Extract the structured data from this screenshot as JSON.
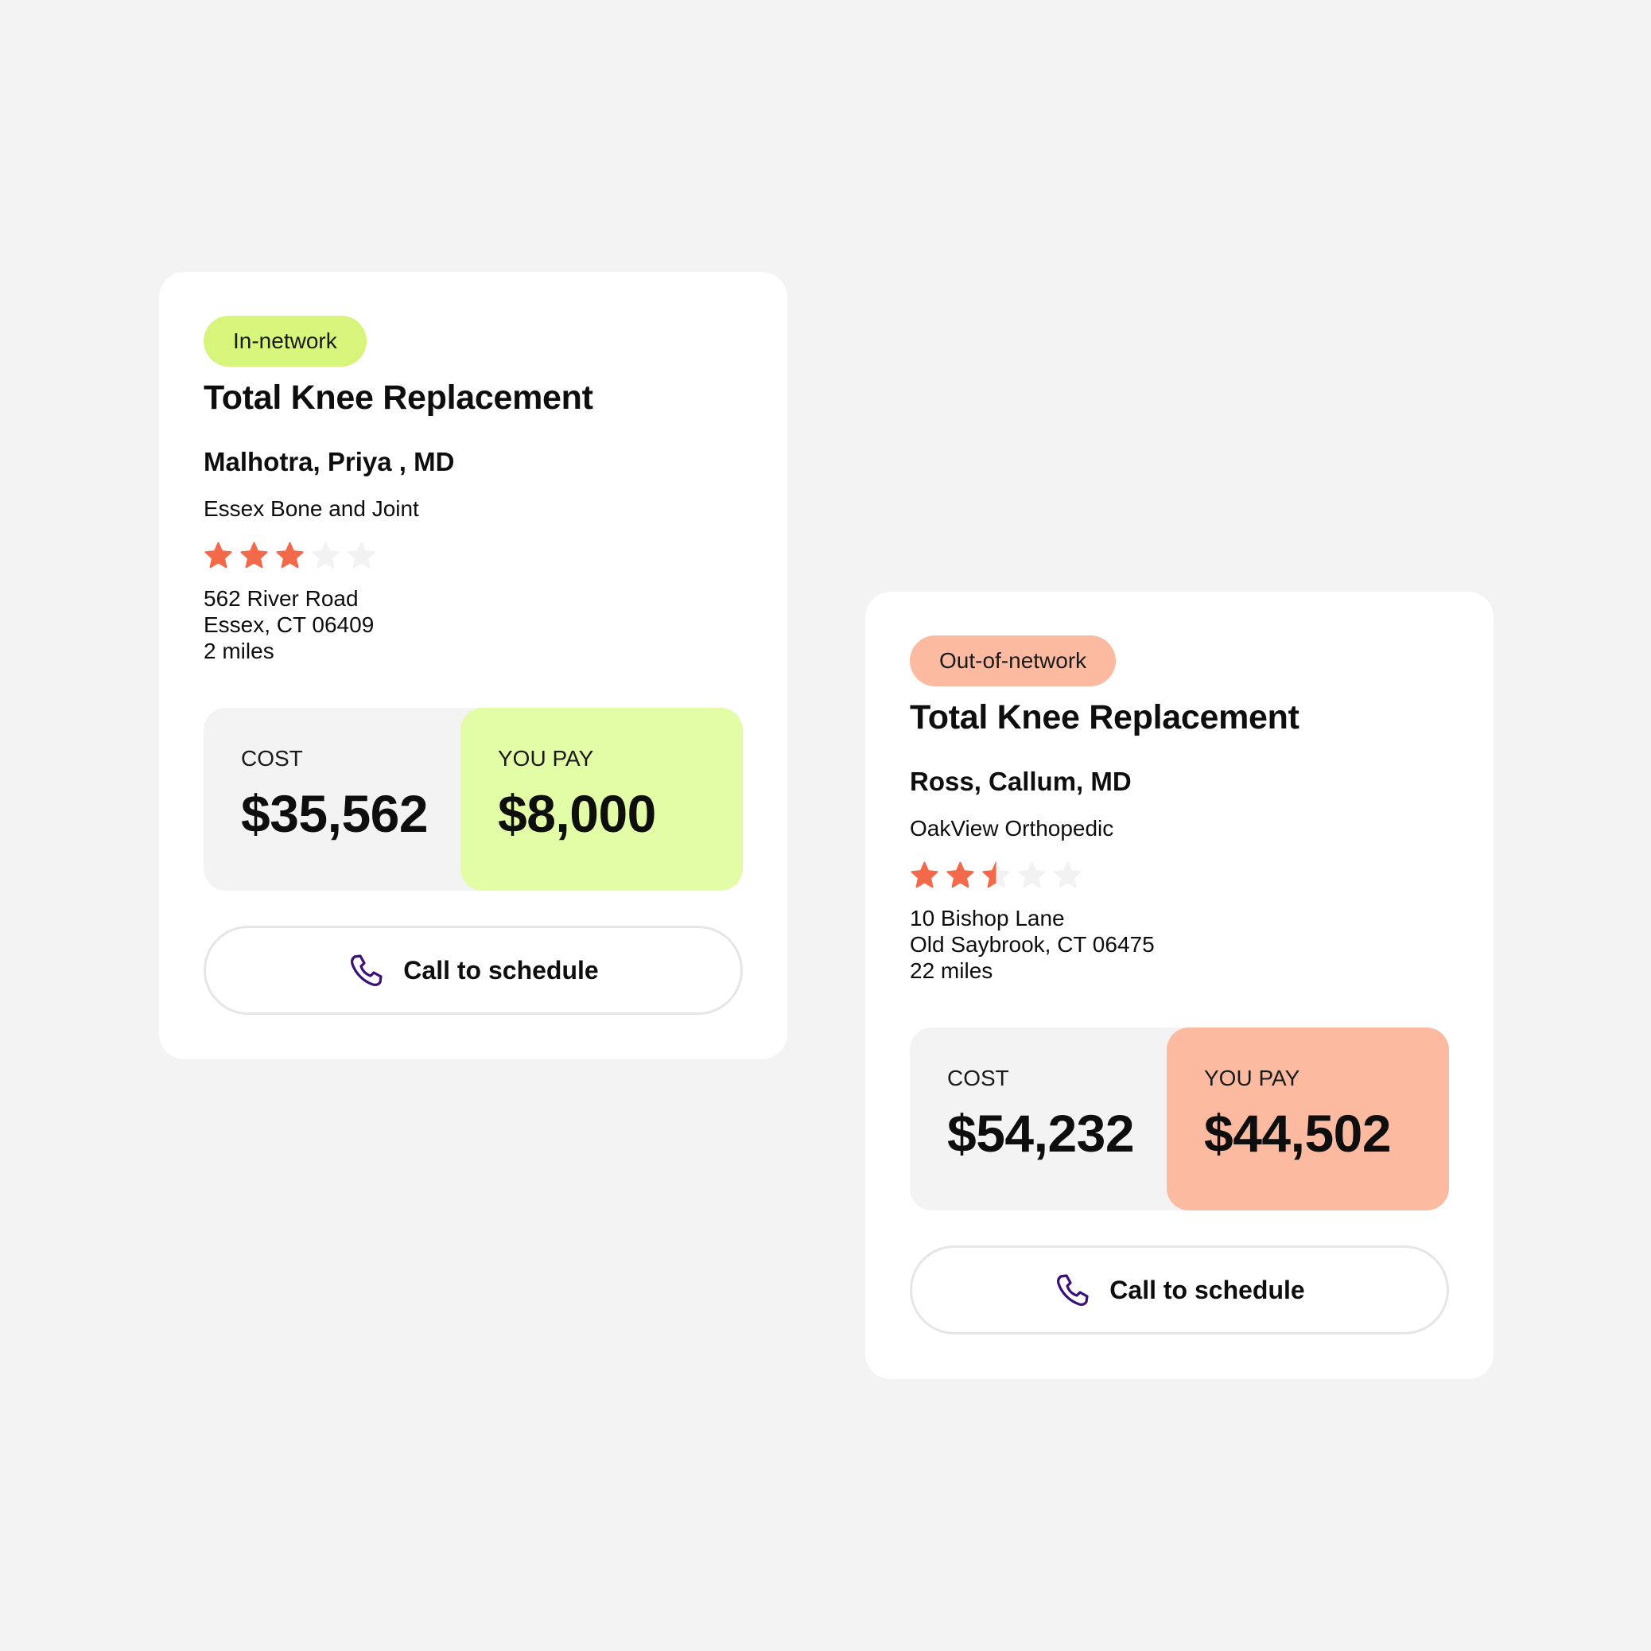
{
  "colors": {
    "background": "#f3f3f3",
    "card": "#ffffff",
    "in_network": "#d6f57a",
    "in_network_pay": "#e3fca6",
    "out_network": "#fcbba0",
    "out_network_pay": "#fcbba0",
    "star_filled": "#f4694a",
    "star_empty": "#f2f2f2",
    "phone_icon": "#3b0f7a"
  },
  "cards": [
    {
      "badge": "In-network",
      "procedure": "Total Knee Replacement",
      "doctor": "Malhotra, Priya , MD",
      "practice": "Essex Bone and Joint",
      "rating": 3,
      "rating_max": 5,
      "address": {
        "street": "562 River Road",
        "city_state_zip": "Essex, CT 06409",
        "distance": "2 miles"
      },
      "cost_label": "COST",
      "cost_value": "$35,562",
      "pay_label": "YOU PAY",
      "pay_value": "$8,000",
      "call_icon": "phone-icon",
      "call_label": "Call to schedule"
    },
    {
      "badge": "Out-of-network",
      "procedure": "Total Knee Replacement",
      "doctor": "Ross, Callum, MD",
      "practice": "OakView Orthopedic",
      "rating": 2.5,
      "rating_max": 5,
      "address": {
        "street": "10 Bishop Lane",
        "city_state_zip": "Old Saybrook, CT 06475",
        "distance": "22 miles"
      },
      "cost_label": "COST",
      "cost_value": "$54,232",
      "pay_label": "YOU PAY",
      "pay_value": "$44,502",
      "call_icon": "phone-icon",
      "call_label": "Call to schedule"
    }
  ]
}
